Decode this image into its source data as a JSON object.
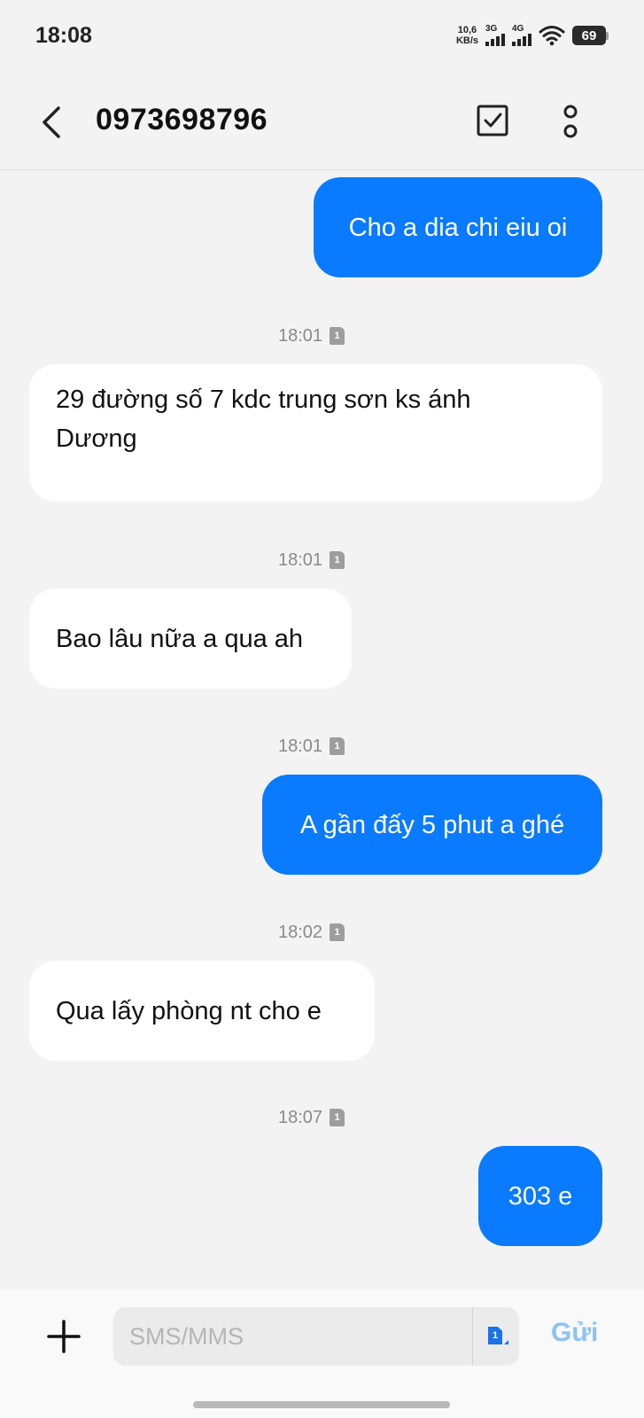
{
  "status_bar": {
    "time": "18:08",
    "net_speed_value": "10,6",
    "net_speed_unit": "KB/s",
    "sim1_label": "3G",
    "sim2_label": "4G",
    "battery": "69"
  },
  "header": {
    "contact": "0973698796"
  },
  "messages": [
    {
      "direction": "outgoing",
      "text": "Cho a dia chi eiu oi"
    },
    {
      "timestamp": "18:01",
      "sim": "1"
    },
    {
      "direction": "incoming",
      "line1": "29 đường số 7 kdc trung sơn ks ánh",
      "line2": "Dương"
    },
    {
      "timestamp": "18:01",
      "sim": "1"
    },
    {
      "direction": "incoming",
      "text": "Bao lâu nữa a qua ah"
    },
    {
      "timestamp": "18:01",
      "sim": "1"
    },
    {
      "direction": "outgoing",
      "text": "A gần đấy 5 phut a ghé"
    },
    {
      "timestamp": "18:02",
      "sim": "1"
    },
    {
      "direction": "incoming",
      "text": "Qua lấy phòng nt cho e"
    },
    {
      "timestamp": "18:07",
      "sim": "1"
    },
    {
      "direction": "outgoing",
      "text": "303 e"
    }
  ],
  "compose": {
    "placeholder": "SMS/MMS",
    "value": "",
    "sim_selected": "1",
    "send_label": "Gửi"
  },
  "colors": {
    "outgoing_bubble": "#0a7aff",
    "incoming_bubble": "#ffffff",
    "background": "#f3f3f3",
    "send_disabled": "#8cc2f5"
  }
}
